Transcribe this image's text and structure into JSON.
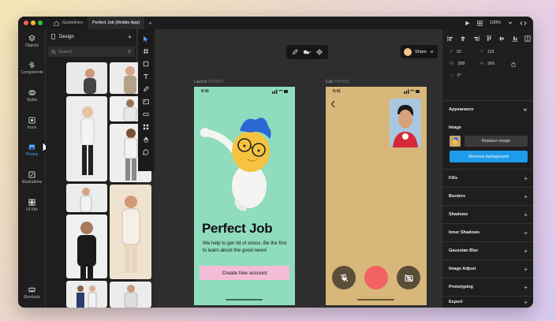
{
  "window": {
    "tabs": [
      {
        "label": "Guidelines"
      },
      {
        "label": "Perfect Job (Mobile App)"
      }
    ],
    "zoom": "100%"
  },
  "rail": {
    "items": [
      {
        "label": "Objects",
        "icon": "layers-icon"
      },
      {
        "label": "Components",
        "icon": "components-icon"
      },
      {
        "label": "Styles",
        "icon": "styles-icon"
      },
      {
        "label": "Icons",
        "icon": "icons-icon"
      },
      {
        "label": "Photos",
        "icon": "photos-icon",
        "active": true
      },
      {
        "label": "Illustrations",
        "icon": "illustrations-icon"
      },
      {
        "label": "UI Kits",
        "icon": "ui-kits-icon"
      }
    ],
    "shortcuts": "Shortcuts"
  },
  "panel": {
    "title": "Design",
    "search_placeholder": "Search"
  },
  "canvas": {
    "share_label": "Share",
    "frames": [
      {
        "name": "Launch",
        "size": "375×812"
      },
      {
        "name": "Call",
        "size": "375×812"
      }
    ],
    "launch": {
      "time": "9:41",
      "title": "Perfect Job",
      "body": "We help to get rid of stress. Be the first to learn about the good news!",
      "cta": "Create free account",
      "bg": "#8fdcbf"
    },
    "call": {
      "time": "9:41",
      "bg": "#d7b77a",
      "end_color": "#f26262"
    }
  },
  "inspector": {
    "x": {
      "label": "X",
      "value": "30"
    },
    "y": {
      "label": "Y",
      "value": "119"
    },
    "w": {
      "label": "W",
      "value": "388"
    },
    "h": {
      "label": "H",
      "value": "366"
    },
    "rotation": "0°",
    "appearance": "Appearance",
    "image_title": "Image",
    "replace_image": "Replace image",
    "remove_background": "Remove background",
    "sections": [
      "Fills",
      "Borders",
      "Shadows",
      "Inner Shadows",
      "Gaussian Blur",
      "Image Adjust",
      "Prototyping",
      "Export"
    ],
    "accent": "#1e9bea"
  }
}
